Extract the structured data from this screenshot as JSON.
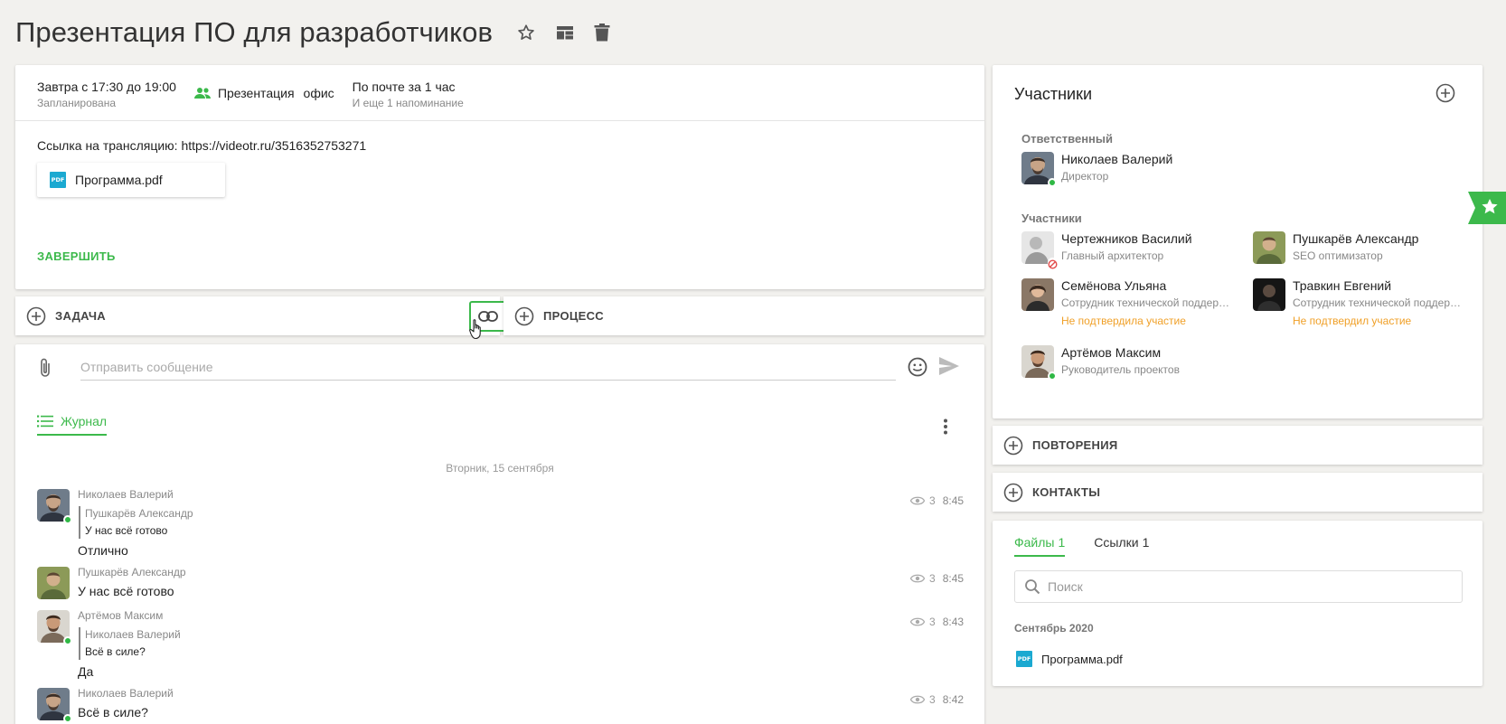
{
  "title": "Презентация ПО для разработчиков",
  "event": {
    "when": "Завтра с 17:30 до 19:00",
    "status": "Запланирована",
    "type": "Презентация",
    "place": "офис",
    "reminder": "По почте за 1 час",
    "reminder_more": "И еще 1 напоминание",
    "description": "Ссылка на трансляцию: https://videotr.ru/3516352753271",
    "file": "Программа.pdf",
    "file_icon": "PDF",
    "finish_label": "ЗАВЕРШИТЬ"
  },
  "bars": {
    "task": "ЗАДАЧА",
    "process": "ПРОЦЕСС"
  },
  "chat": {
    "placeholder": "Отправить сообщение",
    "journal_tab": "Журнал",
    "date": "Вторник, 15 сентября",
    "messages": [
      {
        "author": "Николаев Валерий",
        "quote_author": "Пушкарёв Александр",
        "quote_text": "У нас всё готово",
        "text": "Отлично",
        "views": "3",
        "time": "8:45"
      },
      {
        "author": "Пушкарёв Александр",
        "text": "У нас всё готово",
        "views": "3",
        "time": "8:45"
      },
      {
        "author": "Артёмов Максим",
        "quote_author": "Николаев Валерий",
        "quote_text": "Всё в силе?",
        "text": "Да",
        "views": "3",
        "time": "8:43"
      },
      {
        "author": "Николаев Валерий",
        "text": "Всё в силе?",
        "views": "3",
        "time": "8:42"
      }
    ]
  },
  "participants": {
    "title": "Участники",
    "responsible_label": "Ответственный",
    "responsible": {
      "name": "Николаев Валерий",
      "role": "Директор"
    },
    "members_label": "Участники",
    "members": [
      {
        "name": "Чертежников Василий",
        "role": "Главный архитектор"
      },
      {
        "name": "Пушкарёв Александр",
        "role": "SEO оптимизатор"
      },
      {
        "name": "Семёнова Ульяна",
        "role": "Сотрудник технической поддержки",
        "warn": "Не подтвердила участие"
      },
      {
        "name": "Травкин Евгений",
        "role": "Сотрудник технической поддержки",
        "warn": "Не подтвердил участие"
      },
      {
        "name": "Артёмов Максим",
        "role": "Руководитель проектов"
      }
    ]
  },
  "side": {
    "repeats": "ПОВТОРЕНИЯ",
    "contacts": "КОНТАКТЫ"
  },
  "files": {
    "tab_files": "Файлы",
    "tab_files_count": "1",
    "tab_links": "Ссылки",
    "tab_links_count": "1",
    "search_placeholder": "Поиск",
    "month": "Сентябрь 2020",
    "file": "Программа.pdf"
  },
  "colors": {
    "accent": "#3cb94b",
    "warn": "#f0a028",
    "pdf": "#1ba9d1"
  }
}
